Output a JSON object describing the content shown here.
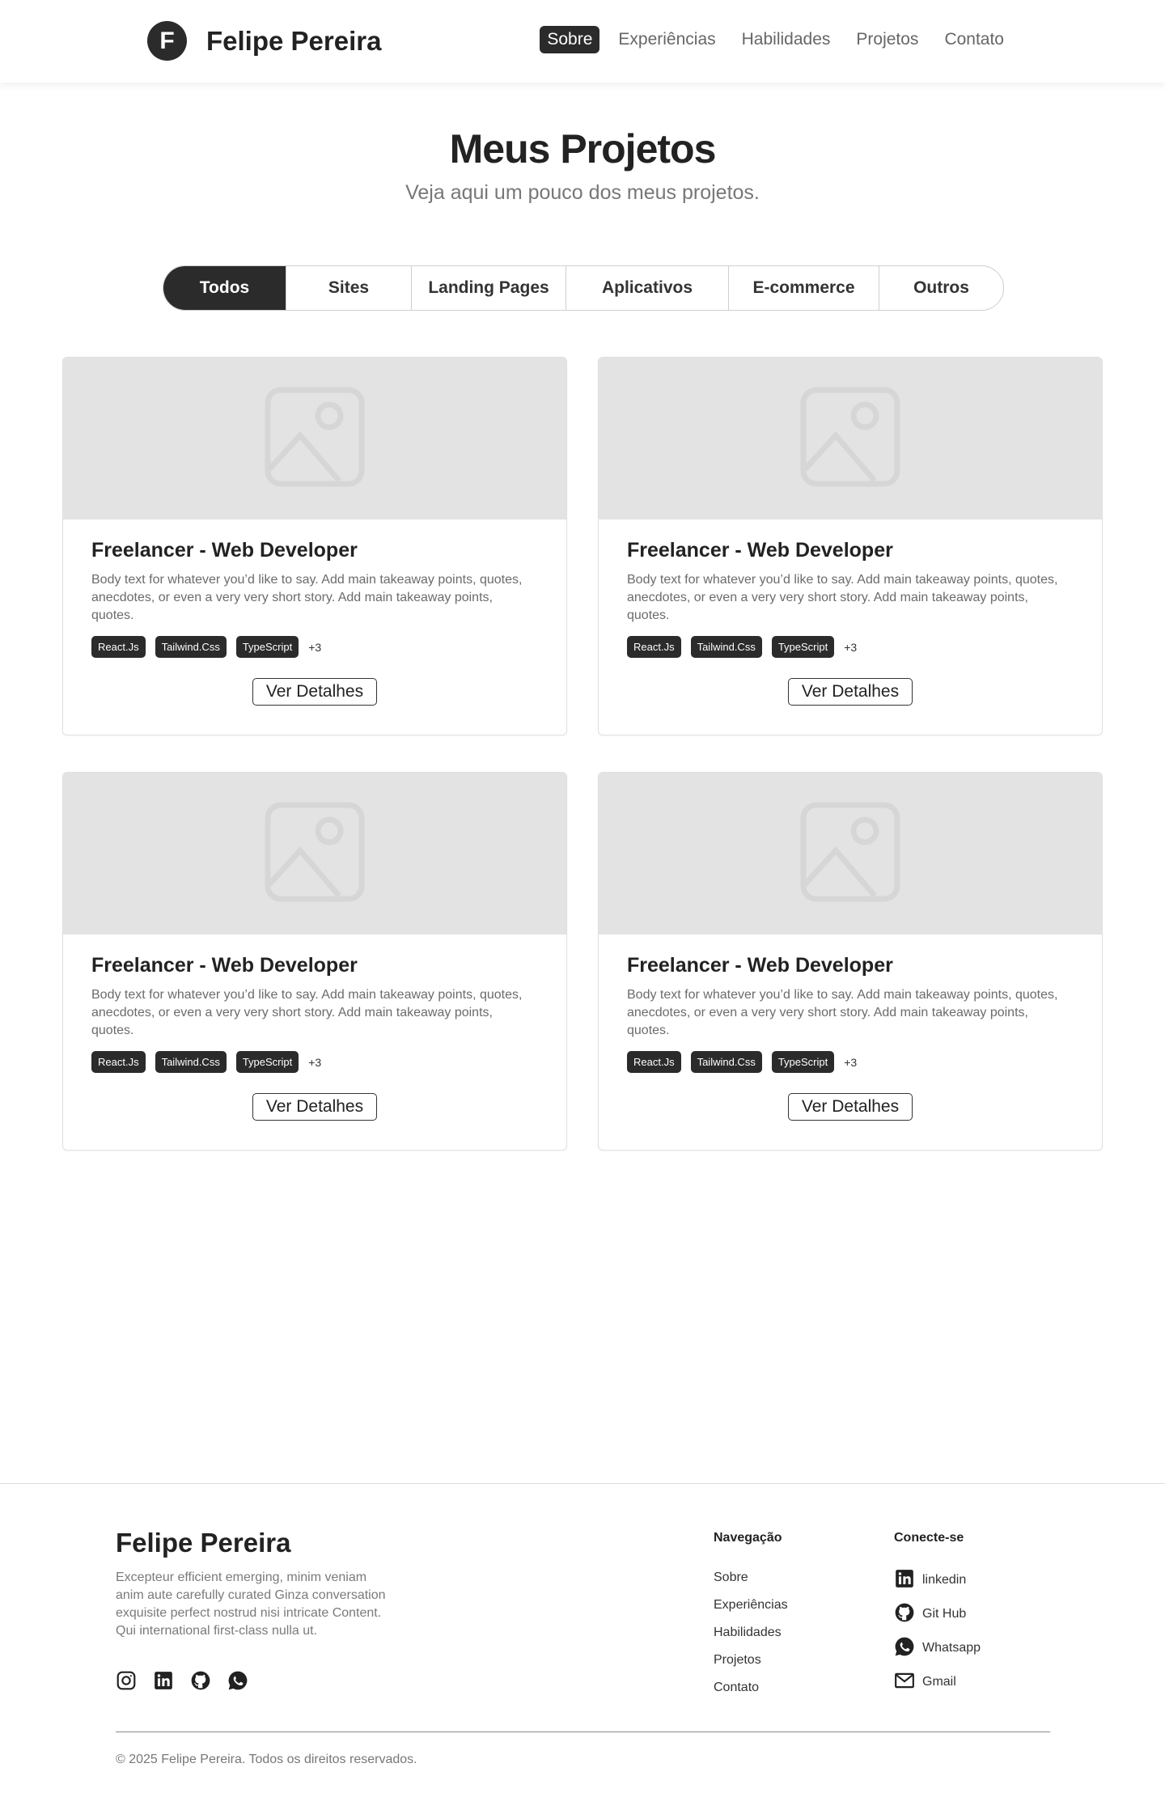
{
  "header": {
    "logo_letter": "F",
    "name": "Felipe Pereira",
    "nav": [
      {
        "label": "Sobre",
        "active": true
      },
      {
        "label": "Experiências",
        "active": false
      },
      {
        "label": "Habilidades",
        "active": false
      },
      {
        "label": "Projetos",
        "active": false
      },
      {
        "label": "Contato",
        "active": false
      }
    ]
  },
  "hero": {
    "title": "Meus Projetos",
    "subtitle": "Veja aqui um pouco dos meus projetos."
  },
  "filters": [
    {
      "label": "Todos",
      "active": true
    },
    {
      "label": "Sites",
      "active": false
    },
    {
      "label": "Landing Pages",
      "active": false
    },
    {
      "label": "Aplicativos",
      "active": false
    },
    {
      "label": "E-commerce",
      "active": false
    },
    {
      "label": "Outros",
      "active": false
    }
  ],
  "projects": [
    {
      "title": "Freelancer - Web Developer",
      "text": "Body text for whatever you’d like to say. Add main takeaway points, quotes, anecdotes, or even a very very short story. Add main takeaway points, quotes.",
      "tags": [
        "React.Js",
        "Tailwind.Css",
        "TypeScript"
      ],
      "more": "+3",
      "button": "Ver Detalhes",
      "image_icon": "image-placeholder-icon"
    },
    {
      "title": "Freelancer - Web Developer",
      "text": "Body text for whatever you’d like to say. Add main takeaway points, quotes, anecdotes, or even a very very short story. Add main takeaway points, quotes.",
      "tags": [
        "React.Js",
        "Tailwind.Css",
        "TypeScript"
      ],
      "more": "+3",
      "button": "Ver Detalhes",
      "image_icon": "image-placeholder-icon"
    },
    {
      "title": "Freelancer - Web Developer",
      "text": "Body text for whatever you’d like to say. Add main takeaway points, quotes, anecdotes, or even a very very short story. Add main takeaway points, quotes.",
      "tags": [
        "React.Js",
        "Tailwind.Css",
        "TypeScript"
      ],
      "more": "+3",
      "button": "Ver Detalhes",
      "image_icon": "image-placeholder-icon"
    },
    {
      "title": "Freelancer - Web Developer",
      "text": "Body text for whatever you’d like to say. Add main takeaway points, quotes, anecdotes, or even a very very short story. Add main takeaway points, quotes.",
      "tags": [
        "React.Js",
        "Tailwind.Css",
        "TypeScript"
      ],
      "more": "+3",
      "button": "Ver Detalhes",
      "image_icon": "image-placeholder-icon"
    }
  ],
  "footer": {
    "brand": "Felipe Pereira",
    "description": "Excepteur efficient emerging, minim veniam anim aute carefully curated Ginza conversation exquisite perfect nostrud nisi intricate Content. Qui  international first-class nulla ut.",
    "social_icons": [
      "instagram-icon",
      "linkedin-icon",
      "github-icon",
      "whatsapp-icon"
    ],
    "nav_title": "Navegação",
    "nav_links": [
      "Sobre",
      "Experiências",
      "Habilidades",
      "Projetos",
      "Contato"
    ],
    "connect_title": "Conecte-se",
    "connect_links": [
      {
        "label": "linkedin",
        "icon": "linkedin-icon"
      },
      {
        "label": "Git Hub",
        "icon": "github-icon"
      },
      {
        "label": "Whatsapp",
        "icon": "whatsapp-icon"
      },
      {
        "label": "Gmail",
        "icon": "mail-icon"
      }
    ],
    "copyright": "© 2025 Felipe Pereira. Todos os direitos reservados."
  },
  "colors": {
    "primary": "#2b2b2b",
    "placeholder_bg": "#e3e3e3",
    "muted_text": "#777777"
  }
}
